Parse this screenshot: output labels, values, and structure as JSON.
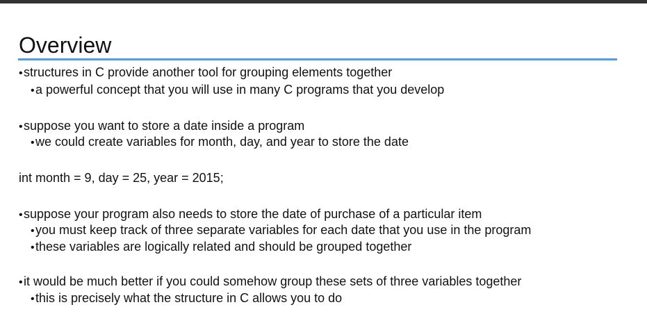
{
  "title": "Overview",
  "bullet_glyph": "•",
  "blocks": [
    {
      "text": "structures in C provide another tool for grouping elements together"
    },
    {
      "text": "a powerful concept that you will use in many C programs that you develop"
    },
    {
      "text": "suppose you want to store a date inside a program"
    },
    {
      "text": "we could create variables for month, day, and year to store the date"
    },
    {
      "text": "int  month = 9, day = 25, year = 2015;"
    },
    {
      "text": "suppose your program also needs to store the date of purchase of a particular item"
    },
    {
      "text": "you must keep track of three separate variables for each date that you use in the program"
    },
    {
      "text": "these variables are logically related and should be grouped together"
    },
    {
      "text": "it would be much better if you could somehow group these sets of three variables together"
    },
    {
      "text": "this is precisely what the structure in C allows you to do"
    }
  ]
}
